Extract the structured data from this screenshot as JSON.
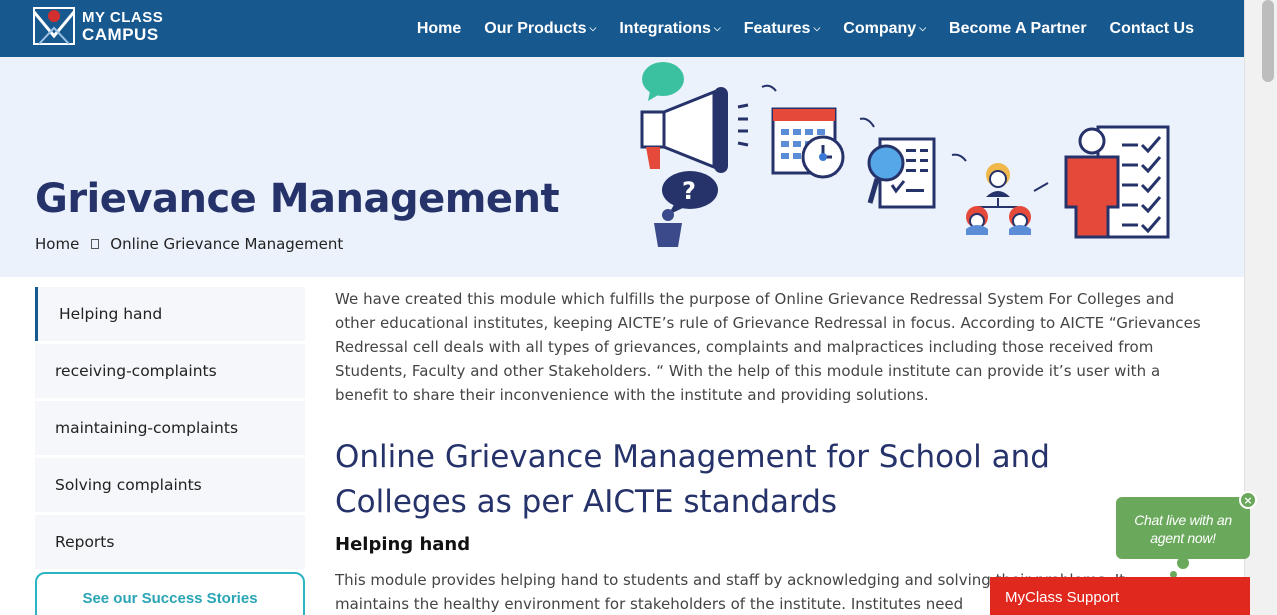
{
  "brand": {
    "line1": "MY CLASS",
    "line2": "CAMPUS"
  },
  "nav": [
    {
      "label": "Home",
      "dropdown": false
    },
    {
      "label": "Our Products",
      "dropdown": true
    },
    {
      "label": "Integrations",
      "dropdown": true
    },
    {
      "label": "Features",
      "dropdown": true
    },
    {
      "label": "Company",
      "dropdown": true
    },
    {
      "label": "Become A Partner",
      "dropdown": false
    },
    {
      "label": "Contact Us",
      "dropdown": false
    }
  ],
  "hero": {
    "title": "Grievance Management",
    "breadcrumb": {
      "home": "Home",
      "current": "Online Grievance Management"
    }
  },
  "sidebar": {
    "items": [
      {
        "label": "Helping hand",
        "active": true
      },
      {
        "label": "receiving-complaints",
        "active": false
      },
      {
        "label": "maintaining-complaints",
        "active": false
      },
      {
        "label": "Solving complaints",
        "active": false
      },
      {
        "label": "Reports",
        "active": false
      }
    ],
    "success_button": "See our Success Stories"
  },
  "content": {
    "intro": "We have created this module which fulfills the purpose of Online Grievance Redressal System For Colleges and other educational institutes, keeping AICTE’s rule of Grievance Redressal in focus. According to AICTE “Grievances Redressal cell deals with all types of grievances, complaints and malpractices including those received from Students, Faculty and other Stakeholders. “ With the help of this module institute can provide it’s user with a benefit to share their inconvenience with the institute and providing solutions.",
    "heading": "Online Grievance Management for School and Colleges as per AICTE standards",
    "subheading": "Helping hand",
    "paragraph": "This module provides helping hand to students and staff by acknowledging and solving their problems. It maintains the healthy environment for stakeholders of the institute. Institutes need"
  },
  "chat": {
    "bubble_text": "Chat live with an agent now!",
    "close_symbol": "×",
    "support_label": "MyClass Support"
  },
  "colors": {
    "nav_bg": "#17588f",
    "hero_bg": "#ebf2fb",
    "heading": "#26336a",
    "accent_teal": "#2bb5c4",
    "chat_green": "#6aa95b",
    "support_red": "#e0281e"
  },
  "icons": [
    "logo-mark-icon",
    "chevron-down-icon",
    "breadcrumb-separator-icon",
    "megaphone-icon",
    "chat-bubble-icon",
    "question-icon",
    "calendar-clock-icon",
    "magnifier-document-icon",
    "team-hierarchy-icon",
    "checklist-person-icon",
    "close-icon"
  ]
}
